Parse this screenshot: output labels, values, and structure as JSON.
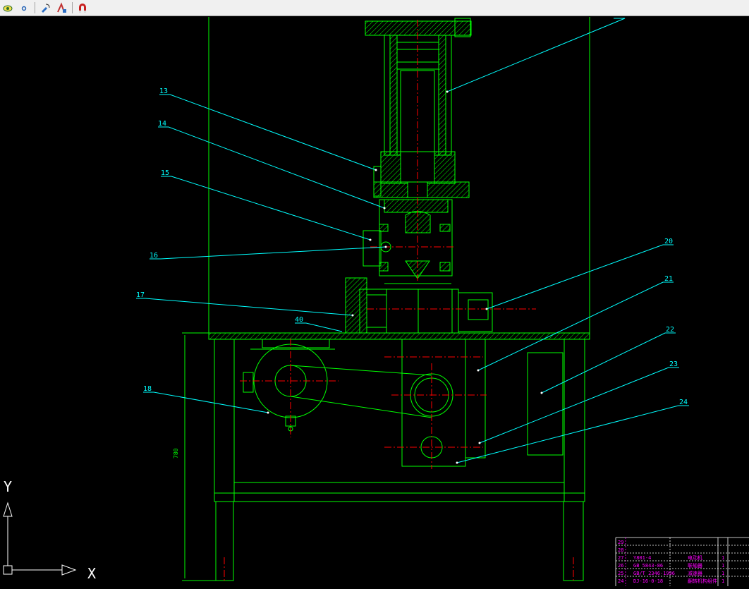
{
  "toolbar": {
    "buttons": [
      {
        "name": "layer-icon"
      },
      {
        "name": "dot-icon"
      },
      {
        "name": "match-properties-icon"
      },
      {
        "name": "draw-tool-icon"
      },
      {
        "name": "magnet-snap-icon"
      }
    ]
  },
  "callouts": {
    "c13": "13",
    "c14": "14",
    "c15": "15",
    "c16": "16",
    "c17": "17",
    "c18": "18",
    "c20": "20",
    "c21": "21",
    "c22": "22",
    "c23": "23",
    "c24": "24"
  },
  "dimension": {
    "small": "40",
    "height": "780"
  },
  "ucs": {
    "x": "X",
    "y": "Y"
  },
  "bom": [
    {
      "no": "29",
      "code": "",
      "name": "",
      "qty": ""
    },
    {
      "no": "28",
      "code": "",
      "name": "",
      "qty": ""
    },
    {
      "no": "27",
      "code": "Y801-4",
      "name": "电动机",
      "qty": "1"
    },
    {
      "no": "26",
      "code": "GB 5843-86",
      "name": "联轴器",
      "qty": "1"
    },
    {
      "no": "25",
      "code": "GB/T 2346-1996",
      "name": "减速器",
      "qty": "1"
    },
    {
      "no": "24",
      "code": "DJ-16-0-18",
      "name": "翻转机构组件",
      "qty": "1"
    }
  ],
  "colors": {
    "drawing": "#00ff00",
    "leader": "#00ffff",
    "centerline": "#ff0000",
    "table_text": "#ff00ff",
    "background": "#000000"
  }
}
